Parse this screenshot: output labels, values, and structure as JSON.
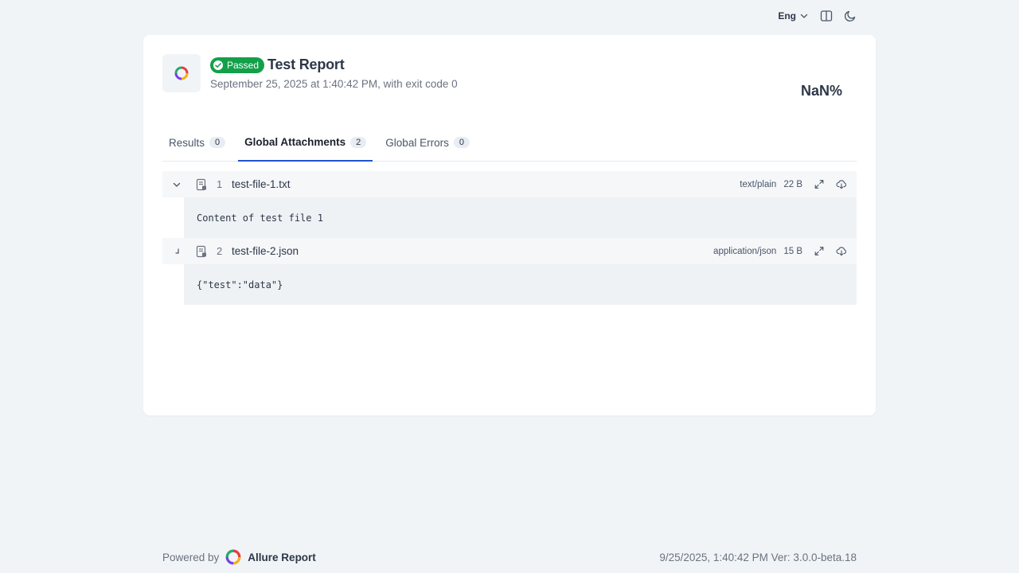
{
  "topbar": {
    "language": "Eng",
    "icons": [
      "chevron-down-icon",
      "layout-icon",
      "moon-icon"
    ]
  },
  "header": {
    "status": "Passed",
    "title": "Test Report",
    "subtitle": "September 25, 2025 at 1:40:42 PM, with exit code 0",
    "percent": "NaN%"
  },
  "tabs": [
    {
      "label": "Results",
      "count": "0"
    },
    {
      "label": "Global Attachments",
      "count": "2"
    },
    {
      "label": "Global Errors",
      "count": "0"
    }
  ],
  "active_tab": "Global Attachments",
  "attachments": [
    {
      "index": "1",
      "name": "test-file-1.txt",
      "mime": "text/plain",
      "size": "22 B",
      "content": "Content of test file 1"
    },
    {
      "index": "2",
      "name": "test-file-2.json",
      "mime": "application/json",
      "size": "15 B",
      "content": "{\"test\":\"data\"}"
    }
  ],
  "footer": {
    "powered_by": "Powered by",
    "brand": "Allure Report",
    "meta": "9/25/2025, 1:40:42 PM Ver: 3.0.0-beta.18"
  },
  "colors": {
    "passed": "#14a04a",
    "accent": "#1f55c7",
    "background": "#f0f4f7"
  }
}
